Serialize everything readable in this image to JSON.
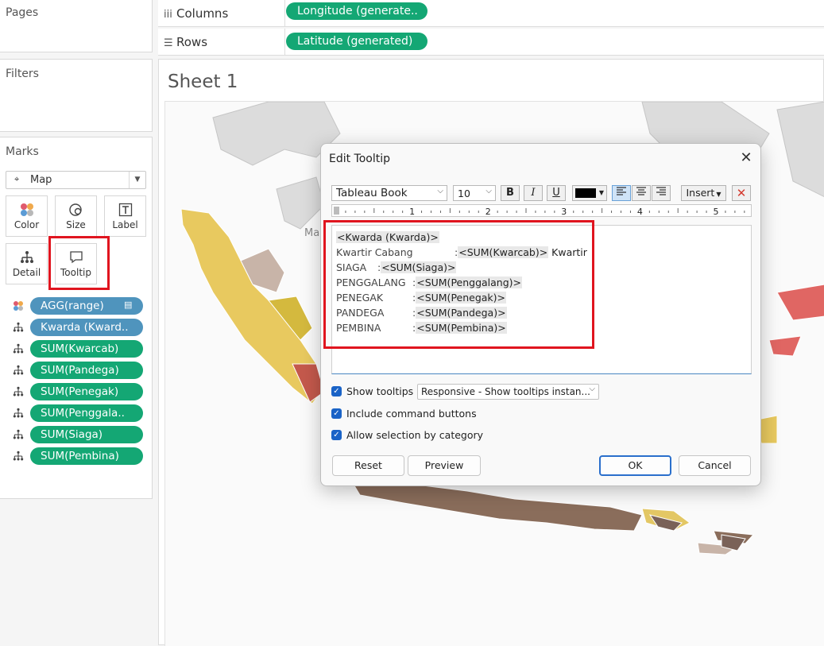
{
  "left_panel": {
    "pages_title": "Pages",
    "filters_title": "Filters",
    "marks_title": "Marks",
    "mark_type": "Map",
    "mark_buttons": {
      "color": "Color",
      "size": "Size",
      "label": "Label",
      "detail": "Detail",
      "tooltip": "Tooltip"
    },
    "fields": [
      {
        "icon": "color-icon",
        "label": "AGG(range)",
        "style": "blue"
      },
      {
        "icon": "detail-icon",
        "label": "Kwarda (Kward..",
        "style": "blue"
      },
      {
        "icon": "detail-icon",
        "label": "SUM(Kwarcab)",
        "style": "green"
      },
      {
        "icon": "detail-icon",
        "label": "SUM(Pandega)",
        "style": "green"
      },
      {
        "icon": "detail-icon",
        "label": "SUM(Penegak)",
        "style": "green"
      },
      {
        "icon": "detail-icon",
        "label": "SUM(Penggala..",
        "style": "green"
      },
      {
        "icon": "detail-icon",
        "label": "SUM(Siaga)",
        "style": "green"
      },
      {
        "icon": "detail-icon",
        "label": "SUM(Pembina)",
        "style": "green"
      }
    ]
  },
  "shelves": {
    "columns_label": "Columns",
    "columns_pill": "Longitude (generate..",
    "rows_label": "Rows",
    "rows_pill": "Latitude (generated)"
  },
  "sheet": {
    "title": "Sheet 1",
    "map_label_fragment": "Ma"
  },
  "dialog": {
    "title": "Edit Tooltip",
    "font_family": "Tableau Book",
    "font_size": "10",
    "insert_label": "Insert",
    "ruler_marks": [
      "1",
      "2",
      "3",
      "4",
      "5"
    ],
    "tooltip_lines": [
      {
        "label": "",
        "sep": "",
        "token": "<Kwarda (Kwarda)>",
        "suffix": ""
      },
      {
        "label": "Kwartir Cabang",
        "sep": ":",
        "token": "<SUM(Kwarcab)>",
        "suffix": " Kwartir"
      },
      {
        "label": "SIAGA",
        "sep": ":",
        "token": "<SUM(Siaga)>",
        "suffix": ""
      },
      {
        "label": "PENGGALANG",
        "sep": ":",
        "token": "<SUM(Penggalang)>",
        "suffix": ""
      },
      {
        "label": "PENEGAK",
        "sep": ":",
        "token": "<SUM(Penegak)>",
        "suffix": ""
      },
      {
        "label": "PANDEGA",
        "sep": ":",
        "token": "<SUM(Pandega)>",
        "suffix": ""
      },
      {
        "label": "PEMBINA",
        "sep": ":",
        "token": "<SUM(Pembina)>",
        "suffix": ""
      }
    ],
    "show_tooltips_label": "Show tooltips",
    "show_tooltips_mode": "Responsive - Show tooltips instan...",
    "include_command_buttons_label": "Include command buttons",
    "allow_selection_label": "Allow selection by category",
    "reset_label": "Reset",
    "preview_label": "Preview",
    "ok_label": "OK",
    "cancel_label": "Cancel"
  },
  "colors": {
    "pill_green": "#14a774",
    "pill_blue": "#4f94bd",
    "highlight_red": "#e0151f",
    "accent_blue": "#1a63c7"
  }
}
